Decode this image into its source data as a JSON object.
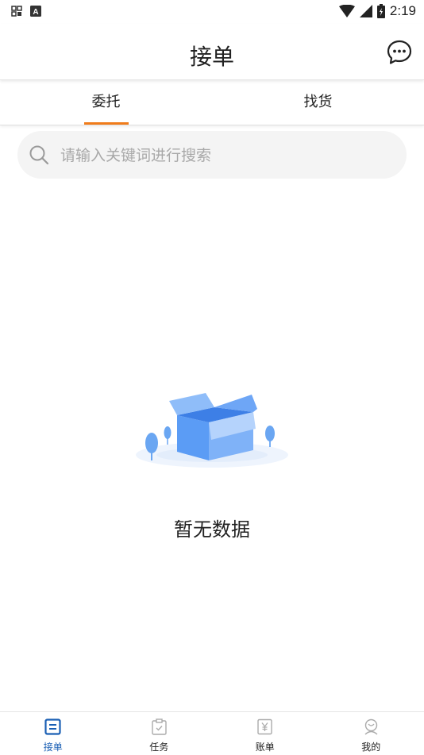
{
  "status_bar": {
    "time": "2:19",
    "left_icons": [
      "sim-icon",
      "keyboard-a-icon"
    ],
    "right_icons": [
      "wifi-icon",
      "signal-icon",
      "battery-charging-icon"
    ]
  },
  "header": {
    "title": "接单",
    "action_icon": "chat-bubble-icon"
  },
  "tabs": [
    {
      "label": "委托",
      "active": true
    },
    {
      "label": "找货",
      "active": false
    }
  ],
  "colors": {
    "accent": "#f07c1b",
    "nav_active": "#1a5fb4",
    "box_blue": "#5b9cf5"
  },
  "search": {
    "placeholder": "请输入关键词进行搜索",
    "value": ""
  },
  "empty_state": {
    "illustration": "empty-box-icon",
    "message": "暂无数据"
  },
  "bottom_nav": [
    {
      "label": "接单",
      "icon": "list-icon",
      "active": true
    },
    {
      "label": "任务",
      "icon": "clipboard-check-icon",
      "active": false
    },
    {
      "label": "账单",
      "icon": "yen-bill-icon",
      "active": false
    },
    {
      "label": "我的",
      "icon": "user-icon",
      "active": false
    }
  ]
}
